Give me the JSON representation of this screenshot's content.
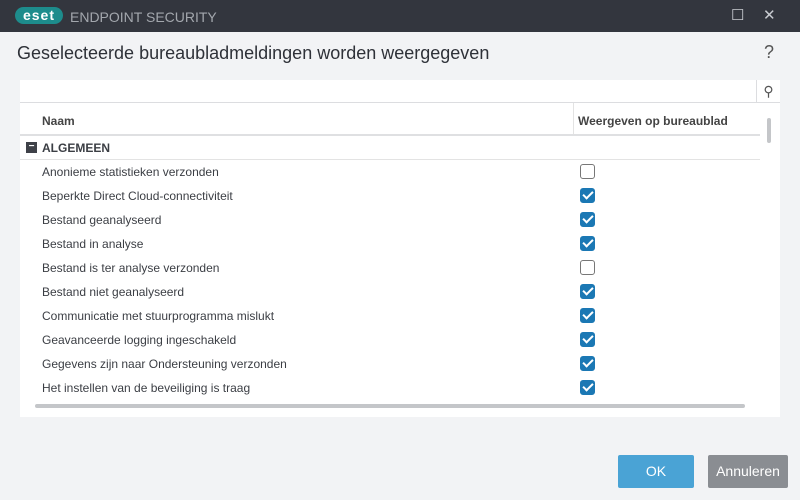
{
  "titlebar": {
    "logo": "eset",
    "app_name": "ENDPOINT SECURITY",
    "minimize": "☐",
    "close": "✕"
  },
  "dialog": {
    "title": "Geselecteerde bureaubladmeldingen worden weergegeven",
    "help": "?"
  },
  "table": {
    "columns": [
      "Naam",
      "Weergeven op bureaublad"
    ],
    "group": "ALGEMEEN",
    "rows": [
      {
        "name": "Anonieme statistieken verzonden",
        "checked": false
      },
      {
        "name": "Beperkte Direct Cloud-connectiviteit",
        "checked": true
      },
      {
        "name": "Bestand geanalyseerd",
        "checked": true
      },
      {
        "name": "Bestand in analyse",
        "checked": true
      },
      {
        "name": "Bestand is ter analyse verzonden",
        "checked": false
      },
      {
        "name": "Bestand niet geanalyseerd",
        "checked": true
      },
      {
        "name": "Communicatie met stuurprogramma mislukt",
        "checked": true
      },
      {
        "name": "Geavanceerde logging ingeschakeld",
        "checked": true
      },
      {
        "name": "Gegevens zijn naar Ondersteuning verzonden",
        "checked": true
      },
      {
        "name": "Het instellen van de beveiliging is traag",
        "checked": true
      }
    ]
  },
  "buttons": {
    "ok": "OK",
    "cancel": "Annuleren"
  }
}
